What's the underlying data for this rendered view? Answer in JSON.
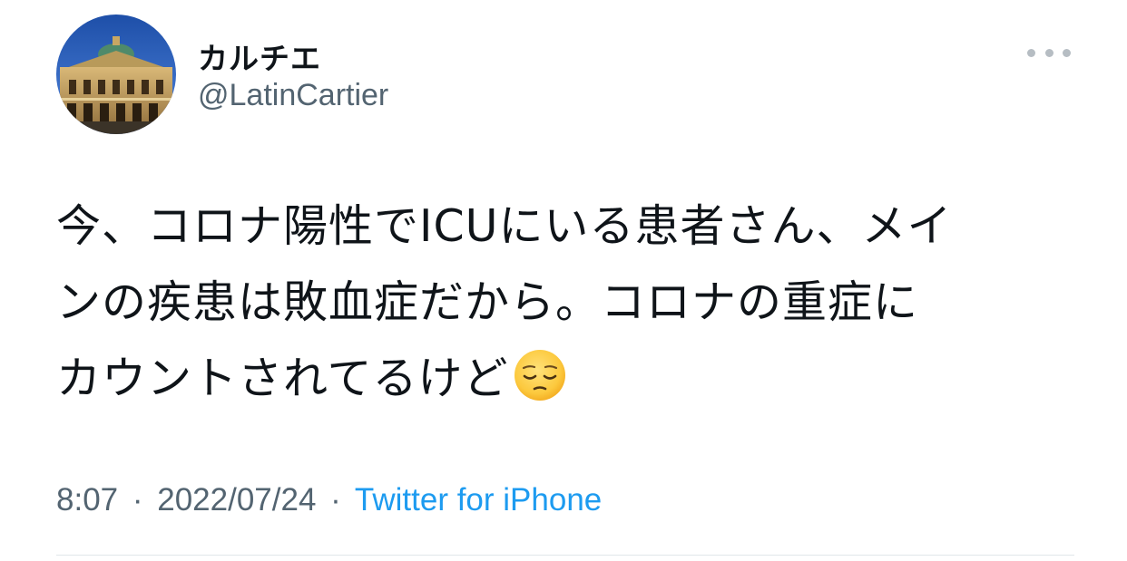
{
  "author": {
    "display_name": "カルチエ",
    "handle": "@LatinCartier"
  },
  "tweet": {
    "lines": [
      "今、コロナ陽性でICUにいる患者さん、メイ",
      "ンの疾患は敗血症だから。コロナの重症に",
      "カウントされてるけど"
    ],
    "emoji": "pensive-face-emoji"
  },
  "meta": {
    "time": "8:07",
    "date": "2022/07/24",
    "separator": "·",
    "source": "Twitter for iPhone"
  },
  "colors": {
    "text": "#0f1419",
    "secondary": "#536471",
    "link": "#1d9bf0",
    "divider": "#e1e6ea"
  }
}
